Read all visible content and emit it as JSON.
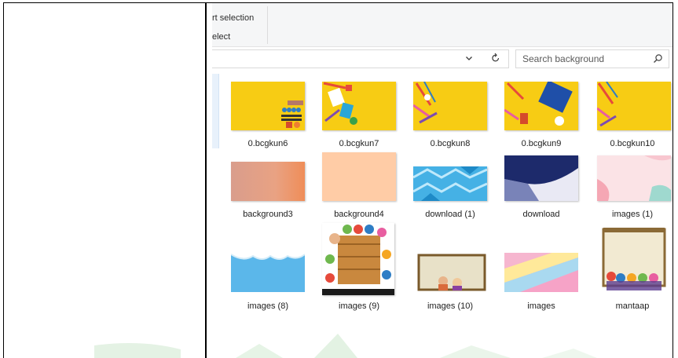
{
  "ribbon": {
    "line1": "rt selection",
    "line2": "elect"
  },
  "address": {
    "dropdown_icon": "chevron-down-icon",
    "refresh_icon": "refresh-icon"
  },
  "search": {
    "placeholder": "Search background",
    "icon": "search-icon"
  },
  "colors": {
    "yellow": "#f7cc14",
    "salmon": "#e99a78",
    "peach": "#ffcca6",
    "sky": "#5bb7ea",
    "navy": "#1d2a6b",
    "pink": "#f8c6cf"
  },
  "files": [
    {
      "name": "0.bcgkun6"
    },
    {
      "name": "0.bcgkun7"
    },
    {
      "name": "0.bcgkun8"
    },
    {
      "name": "0.bcgkun9"
    },
    {
      "name": "0.bcgkun10"
    },
    {
      "name": "background3"
    },
    {
      "name": "background4"
    },
    {
      "name": "download (1)"
    },
    {
      "name": "download"
    },
    {
      "name": "images (1)"
    },
    {
      "name": "images (8)"
    },
    {
      "name": "images (9)"
    },
    {
      "name": "images (10)"
    },
    {
      "name": "images"
    },
    {
      "name": "mantaap"
    }
  ]
}
